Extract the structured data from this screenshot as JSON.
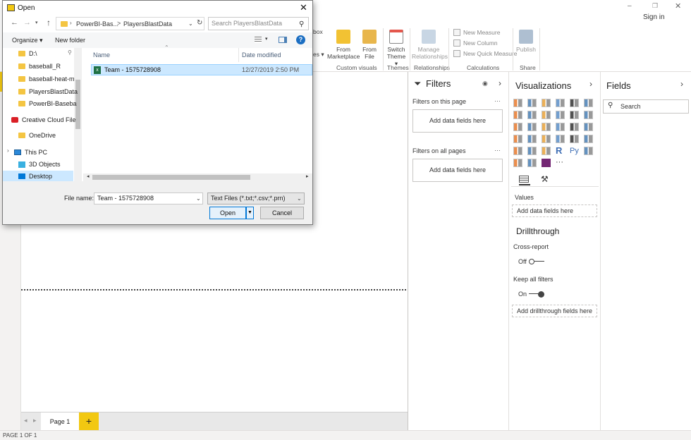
{
  "app": {
    "sign_in": "Sign in",
    "window_controls": [
      "–",
      "❐",
      "✕"
    ]
  },
  "ribbon": {
    "partial_texts": [
      "box",
      "es ▾"
    ],
    "buttons": [
      {
        "label": "From Marketplace",
        "icon": "marketplace-icon",
        "color": "#f2c233"
      },
      {
        "label": "From File",
        "icon": "file-folder-icon",
        "color": "#e8b64c"
      },
      {
        "label": "Switch Theme ▾",
        "icon": "theme-icon",
        "color": "#e4574c"
      },
      {
        "label": "Manage Relationships",
        "icon": "relationships-icon",
        "color": "#8aa7c4"
      },
      {
        "label": "Publish",
        "icon": "publish-icon",
        "color": "#6f8fb0"
      }
    ],
    "small_buttons": [
      "New Measure",
      "New Column",
      "New Quick Measure"
    ],
    "groups": [
      "Custom visuals",
      "Themes",
      "Relationships",
      "Calculations",
      "Share"
    ]
  },
  "canvas": {
    "page_tab": "Page 1",
    "add_page": "+",
    "status": "PAGE 1 OF 1",
    "nav_prev": "◂",
    "nav_next": "▸"
  },
  "filters": {
    "title": "Filters",
    "on_page": "Filters on this page",
    "on_all": "Filters on all pages",
    "drop": "Add data fields here",
    "more": "…"
  },
  "visualizations": {
    "title": "Visualizations",
    "values_label": "Values",
    "values_drop": "Add data fields here",
    "drillthrough": "Drillthrough",
    "cross_report": "Cross-report",
    "cross_report_state": "Off",
    "keep_filters": "Keep all filters",
    "keep_filters_state": "On",
    "drill_drop": "Add drillthrough fields here",
    "more_visuals": "···",
    "r_label": "R",
    "py_label": "Py"
  },
  "fields": {
    "title": "Fields",
    "search_placeholder": "Search"
  },
  "dialog": {
    "title": "Open",
    "close": "✕",
    "breadcrumb": [
      "PowerBI-Bas...",
      ">",
      "PlayersBlastData"
    ],
    "search_placeholder": "Search PlayersBlastData",
    "organize": "Organize ▾",
    "new_folder": "New folder",
    "tree": [
      {
        "label": "D:\\",
        "type": "folder"
      },
      {
        "label": "baseball_R",
        "type": "folder"
      },
      {
        "label": "baseball-heat-m",
        "type": "folder"
      },
      {
        "label": "PlayersBlastData",
        "type": "folder"
      },
      {
        "label": "PowerBI-Baseba",
        "type": "folder"
      },
      {
        "label": "Creative Cloud File",
        "type": "cloud"
      },
      {
        "label": "OneDrive",
        "type": "folder"
      },
      {
        "label": "This PC",
        "type": "pc"
      },
      {
        "label": "3D Objects",
        "type": "folder3d"
      },
      {
        "label": "Desktop",
        "type": "desktop"
      }
    ],
    "columns": [
      "Name",
      "Date modified"
    ],
    "files": [
      {
        "name": "Team - 1575728908",
        "modified": "12/27/2019 2:50 PM"
      }
    ],
    "filename_label": "File name:",
    "filename_value": "Team - 1575728908",
    "filetype_value": "Text Files (*.txt;*.csv;*.prn)",
    "open_button": "Open",
    "cancel_button": "Cancel",
    "help": "?"
  }
}
